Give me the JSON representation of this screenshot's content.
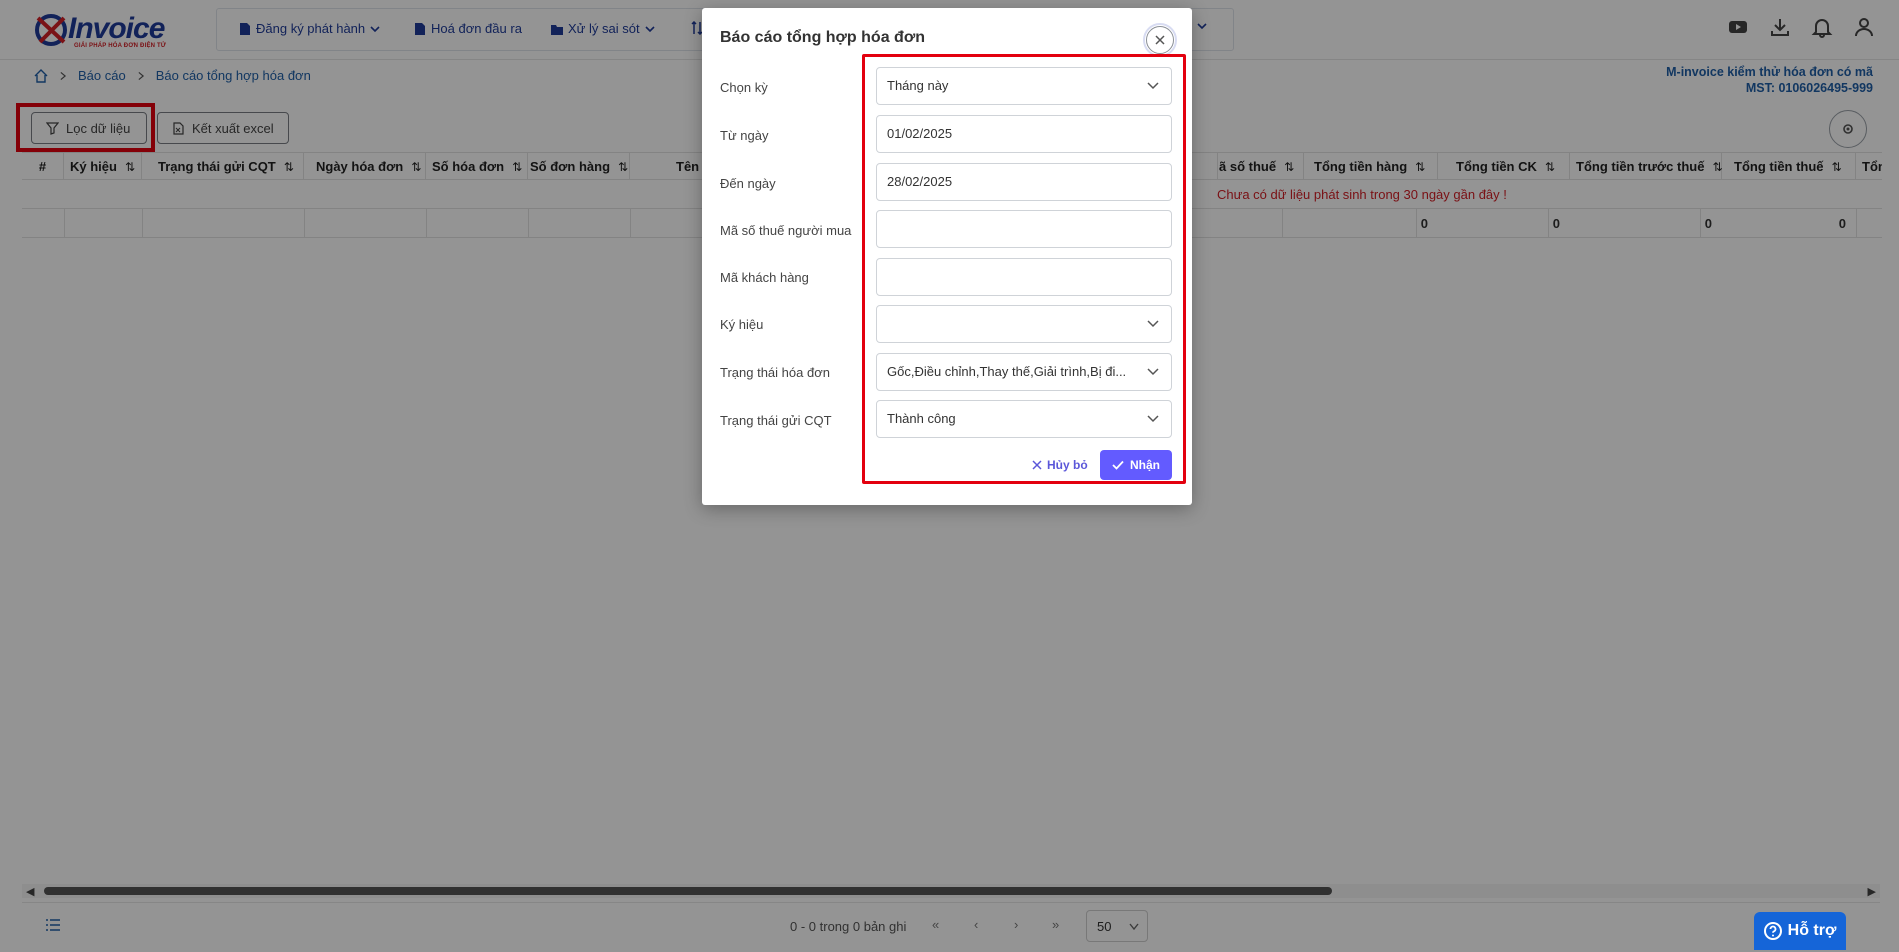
{
  "app": {
    "logo_text": "Invoice",
    "logo_tagline": "GIẢI PHÁP HÓA ĐƠN ĐIỆN TỬ",
    "nav": [
      {
        "label": "Đăng ký phát hành"
      },
      {
        "label": "Hoá đơn đầu ra"
      },
      {
        "label": "Xử lý sai sót"
      }
    ]
  },
  "breadcrumb": {
    "items": [
      "Báo cáo",
      "Báo cáo tổng hợp hóa đơn"
    ]
  },
  "company": {
    "name": "M-invoice kiểm thử hóa đơn có mã",
    "tax_code": "MST: 0106026495-999"
  },
  "toolbar": {
    "filter_label": "Lọc dữ liệu",
    "export_label": "Kết xuất excel"
  },
  "table": {
    "columns": [
      "#",
      "Ký hiệu",
      "Trạng thái gửi CQT",
      "Ngày hóa đơn",
      "Số hóa đơn",
      "Số đơn hàng",
      "Tên",
      "ã số thuế",
      "Tổng tiền hàng",
      "Tổng tiền CK",
      "Tổng tiền trước thuế",
      "Tổng tiền thuế",
      "Tổng t"
    ],
    "empty_message": "Chưa có dữ liệu phát sinh trong 30 ngày gần đây !",
    "totals": [
      "0",
      "0",
      "0",
      "0"
    ]
  },
  "pagination": {
    "info": "0 - 0 trong 0 bản ghi",
    "first": "«",
    "prev": "‹",
    "next": "›",
    "last": "»",
    "page_size": "50"
  },
  "support": {
    "label": "Hỗ trợ"
  },
  "modal": {
    "title": "Báo cáo tổng hợp hóa đơn",
    "fields": {
      "period": {
        "label": "Chọn kỳ",
        "value": "Tháng này"
      },
      "from_date": {
        "label": "Từ ngày",
        "value": "01/02/2025"
      },
      "to_date": {
        "label": "Đến ngày",
        "value": "28/02/2025"
      },
      "buyer_tax": {
        "label": "Mã số thuế người mua",
        "value": ""
      },
      "customer_code": {
        "label": "Mã khách hàng",
        "value": ""
      },
      "symbol": {
        "label": "Ký hiệu",
        "value": ""
      },
      "invoice_status": {
        "label": "Trạng thái hóa đơn",
        "value": "Gốc,Điều chỉnh,Thay thế,Giải trình,Bị đi..."
      },
      "cqt_status": {
        "label": "Trạng thái gửi CQT",
        "value": "Thành công"
      }
    },
    "cancel_label": "Hủy bỏ",
    "submit_label": "Nhận"
  },
  "colors": {
    "brand": "#1f3c9a",
    "highlight": "#e3000f",
    "primary_button": "#635bff",
    "support": "#1565d8",
    "error_text": "#d32027"
  }
}
